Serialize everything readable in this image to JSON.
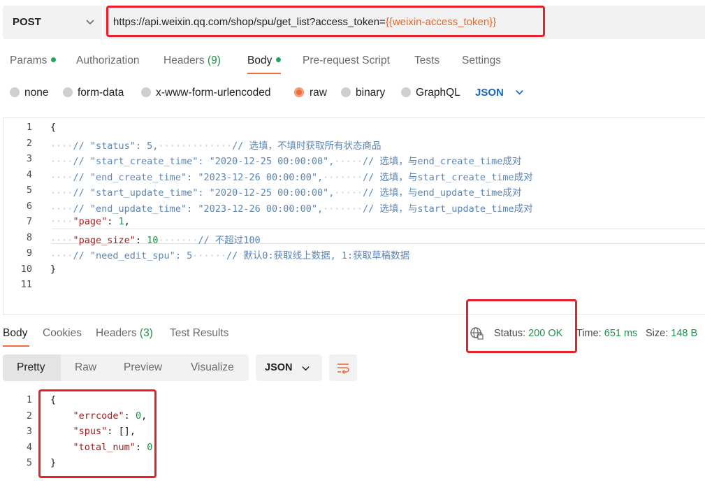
{
  "request": {
    "method": "POST",
    "url_base": "https://api.weixin.qq.com/shop/spu/get_list?access_token=",
    "url_variable": "{{weixin-access_token}}"
  },
  "tabs": [
    {
      "label": "Params",
      "dot": true
    },
    {
      "label": "Authorization"
    },
    {
      "label": "Headers",
      "count": "(9)"
    },
    {
      "label": "Body",
      "dot": true,
      "active": true
    },
    {
      "label": "Pre-request Script"
    },
    {
      "label": "Tests"
    },
    {
      "label": "Settings"
    }
  ],
  "body_types": [
    "none",
    "form-data",
    "x-www-form-urlencoded",
    "raw",
    "binary",
    "GraphQL"
  ],
  "body_type_selected": "raw",
  "body_format": "JSON",
  "request_body": {
    "line_numbers": [
      "1",
      "2",
      "3",
      "4",
      "5",
      "6",
      "7",
      "8",
      "9",
      "10",
      "11"
    ],
    "l1": "{",
    "l2_code": "// \"status\": 5,",
    "l2_comment": "// 选填，不填时获取所有状态商品",
    "l3_code": "// \"start_create_time\": \"2020-12-25 00:00:00\",",
    "l3_comment": "// 选填，与end_create_time成对",
    "l4_code": "// \"end_create_time\": \"2023-12-26 00:00:00\",",
    "l4_comment": "// 选填，与start_create_time成对",
    "l5_code": "// \"start_update_time\": \"2020-12-25 00:00:00\",",
    "l5_comment": "// 选填，与end_update_time成对",
    "l6_code": "// \"end_update_time\": \"2023-12-26 00:00:00\",",
    "l6_comment": "// 选填，与start_update_time成对",
    "l7_key": "\"page\"",
    "l7_colon": ": ",
    "l7_val": "1",
    "l7_end": ",",
    "l8_key": "\"page_size\"",
    "l8_colon": ": ",
    "l8_val": "10",
    "l8_comment": "// 不超过100",
    "l9_code": "// \"need_edit_spu\": 5",
    "l9_comment": "// 默认0:获取线上数据, 1:获取草稿数据",
    "l10": "}"
  },
  "response": {
    "tabs": [
      {
        "label": "Body",
        "active": true
      },
      {
        "label": "Cookies"
      },
      {
        "label": "Headers",
        "count": "(3)"
      },
      {
        "label": "Test Results"
      }
    ],
    "status_label": "Status:",
    "status_value": "200 OK",
    "time_label": "Time:",
    "time_value": "651 ms",
    "size_label": "Size:",
    "size_value": "148 B",
    "view_modes": [
      "Pretty",
      "Raw",
      "Preview",
      "Visualize"
    ],
    "view_selected": "Pretty",
    "format": "JSON",
    "line_numbers": [
      "1",
      "2",
      "3",
      "4",
      "5"
    ],
    "l1": "{",
    "l2_key": "\"errcode\"",
    "l2_val": "0",
    "l2_end": ",",
    "l3_key": "\"spus\"",
    "l3_val": "[]",
    "l3_end": ",",
    "l4_key": "\"total_num\"",
    "l4_val": "0",
    "l5": "}"
  },
  "colors": {
    "accent": "#f26b3a",
    "highlight_box": "#e8202a",
    "success": "#1f8f4c",
    "link": "#1567c7"
  }
}
